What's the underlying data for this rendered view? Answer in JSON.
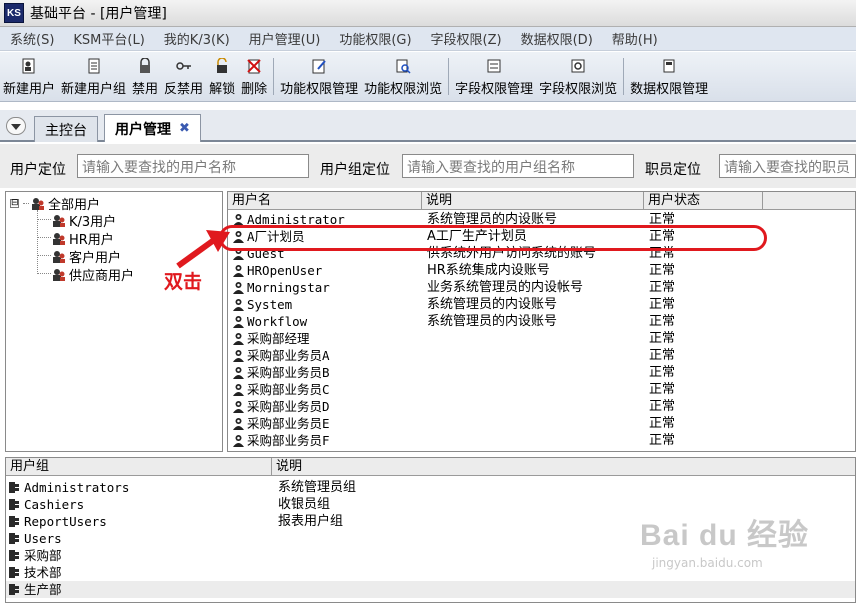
{
  "window": {
    "title": "基础平台 - [用户管理]",
    "app_icon_text": "KS"
  },
  "menu": [
    "系统(S)",
    "KSM平台(L)",
    "我的K/3(K)",
    "用户管理(U)",
    "功能权限(G)",
    "字段权限(Z)",
    "数据权限(D)",
    "帮助(H)"
  ],
  "toolbar": {
    "new_user": "新建用户",
    "new_group": "新建用户组",
    "disable": "禁用",
    "enable": "反禁用",
    "unlock": "解锁",
    "delete": "删除",
    "func_perm_manage": "功能权限管理",
    "func_perm_browse": "功能权限浏览",
    "field_perm_manage": "字段权限管理",
    "field_perm_browse": "字段权限浏览",
    "data_perm_manage": "数据权限管理"
  },
  "tabs": {
    "main": "主控台",
    "user_mgmt": "用户管理",
    "close": "✖"
  },
  "search": {
    "user_label": "用户定位",
    "user_placeholder": "请输入要查找的用户名称",
    "group_label": "用户组定位",
    "group_placeholder": "请输入要查找的用户组名称",
    "position_label": "职员定位",
    "position_placeholder": "请输入要查找的职员"
  },
  "tree": {
    "root": "全部用户",
    "children": [
      "K/3用户",
      "HR用户",
      "客户用户",
      "供应商用户"
    ],
    "toggle": "⊟"
  },
  "user_table": {
    "headers": [
      "用户名",
      "说明",
      "用户状态"
    ],
    "rows": [
      {
        "name": "Administrator",
        "desc": "系统管理员的内设账号",
        "status": "正常"
      },
      {
        "name": "A厂计划员",
        "desc": "A工厂生产计划员",
        "status": "正常"
      },
      {
        "name": "Guest",
        "desc": "供系统外用户访问系统的账号",
        "status": "正常"
      },
      {
        "name": "HROpenUser",
        "desc": "HR系统集成内设账号",
        "status": "正常"
      },
      {
        "name": "Morningstar",
        "desc": "业务系统管理员的内设帐号",
        "status": "正常"
      },
      {
        "name": "System",
        "desc": "系统管理员的内设账号",
        "status": "正常"
      },
      {
        "name": "Workflow",
        "desc": "系统管理员的内设账号",
        "status": "正常"
      },
      {
        "name": "采购部经理",
        "desc": "",
        "status": "正常"
      },
      {
        "name": "采购部业务员A",
        "desc": "",
        "status": "正常"
      },
      {
        "name": "采购部业务员B",
        "desc": "",
        "status": "正常"
      },
      {
        "name": "采购部业务员C",
        "desc": "",
        "status": "正常"
      },
      {
        "name": "采购部业务员D",
        "desc": "",
        "status": "正常"
      },
      {
        "name": "采购部业务员E",
        "desc": "",
        "status": "正常"
      },
      {
        "name": "采购部业务员F",
        "desc": "",
        "status": "正常"
      }
    ]
  },
  "group_table": {
    "headers": [
      "用户组",
      "说明"
    ],
    "rows": [
      {
        "name": "Administrators",
        "desc": "系统管理员组"
      },
      {
        "name": "Cashiers",
        "desc": "收银员组"
      },
      {
        "name": "ReportUsers",
        "desc": "报表用户组"
      },
      {
        "name": "Users",
        "desc": ""
      },
      {
        "name": "采购部",
        "desc": ""
      },
      {
        "name": "技术部",
        "desc": ""
      },
      {
        "name": "生产部",
        "desc": ""
      }
    ]
  },
  "annotation": {
    "text": "双击",
    "color": "#e0191e"
  },
  "watermark": {
    "main": "Bai du 经验",
    "sub": "jingyan.baidu.com"
  }
}
